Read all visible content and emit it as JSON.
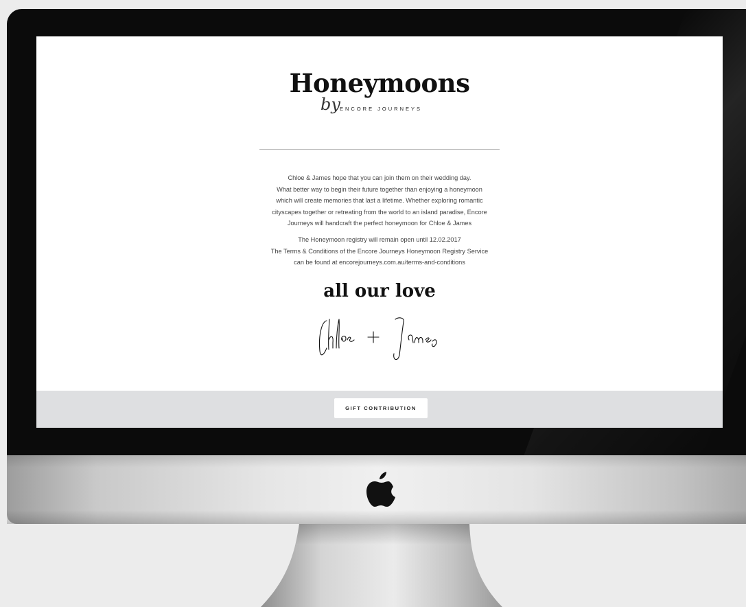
{
  "screen": {
    "brand": {
      "title": "Honeymoons",
      "by": "by",
      "subtitle": "ENCORE JOURNEYS"
    },
    "intro_lines": [
      "Chloe & James hope that you can join them on their wedding day.",
      "What better way to begin their future together than enjoying a honeymoon",
      "which will create memories that last a lifetime. Whether exploring romantic",
      "cityscapes together or retreating from the world to an island paradise, Encore",
      "Journeys will handcraft the perfect honeymoon for Chloe & James"
    ],
    "registry_lines": [
      "The Honeymoon registry will remain open until 12.02.2017",
      "The Terms & Conditions of the Encore Journeys Honeymoon Registry Service",
      "can be found at encorejourneys.com.au/terms-and-conditions"
    ],
    "closing": "all our love",
    "signature": "Chloe + James",
    "footer": {
      "button_label": "GIFT CONTRIBUTION"
    }
  },
  "device": {
    "logo_icon": "apple-logo-icon"
  },
  "colors": {
    "screen_background": "#ffffff",
    "footer_band": "#dedfe1",
    "bezel": "#0b0b0b",
    "text_dark": "#111111",
    "body_text": "#444444"
  }
}
